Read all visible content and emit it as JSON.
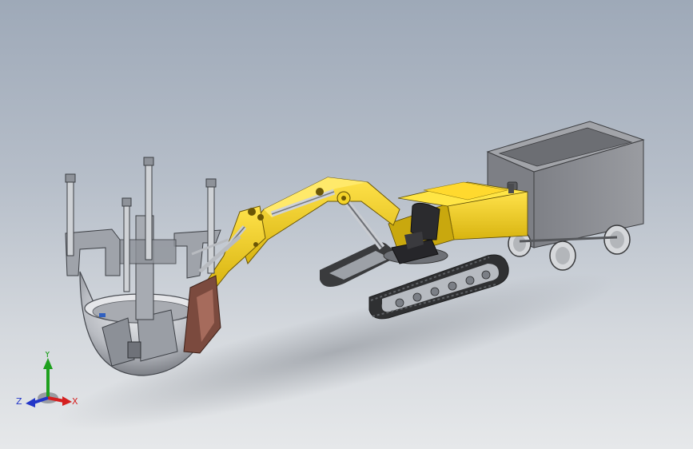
{
  "viewport": {
    "background_top": "#9ea9b8",
    "background_bottom": "#e6e8ea"
  },
  "colors": {
    "machine_yellow": "#f2d21c",
    "machine_yellow_dark": "#b89a0a",
    "steel_gray": "#8f949b",
    "steel_light": "#c9ccd1",
    "track_dark": "#3a3b3d",
    "seat_black": "#2b2b2e",
    "bin_gray": "#8b8d92",
    "axis_x": "#d42020",
    "axis_y": "#1ea01e",
    "axis_z": "#2336c8"
  },
  "triad": {
    "x_label": "X",
    "y_label": "Y",
    "z_label": "Z"
  },
  "icons": {
    "triad": "coordinate-triad-icon"
  }
}
